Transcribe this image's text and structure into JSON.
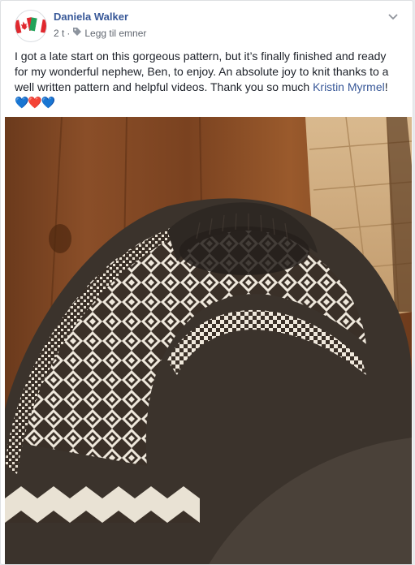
{
  "post": {
    "author": "Daniela Walker",
    "time": "2 t",
    "separator": "·",
    "tag_label": "Legg til emner",
    "text_main": "I got a late start on this gorgeous pattern, but it’s finally finished and ready for my wonderful nephew, Ben, to enjoy. An absolute joy to knit thanks to a well written pattern and helpful videos. Thank you so much ",
    "mention": "Kristin Myrmel",
    "text_end": "!",
    "emojis": "💙❤️💙"
  },
  "colors": {
    "link": "#385898",
    "text": "#1d2129",
    "meta": "#616770",
    "border": "#dddfe2"
  },
  "icons": {
    "avatar": "canada-italy-flags-avatar",
    "tag": "tag-icon",
    "menu": "chevron-down-icon"
  }
}
